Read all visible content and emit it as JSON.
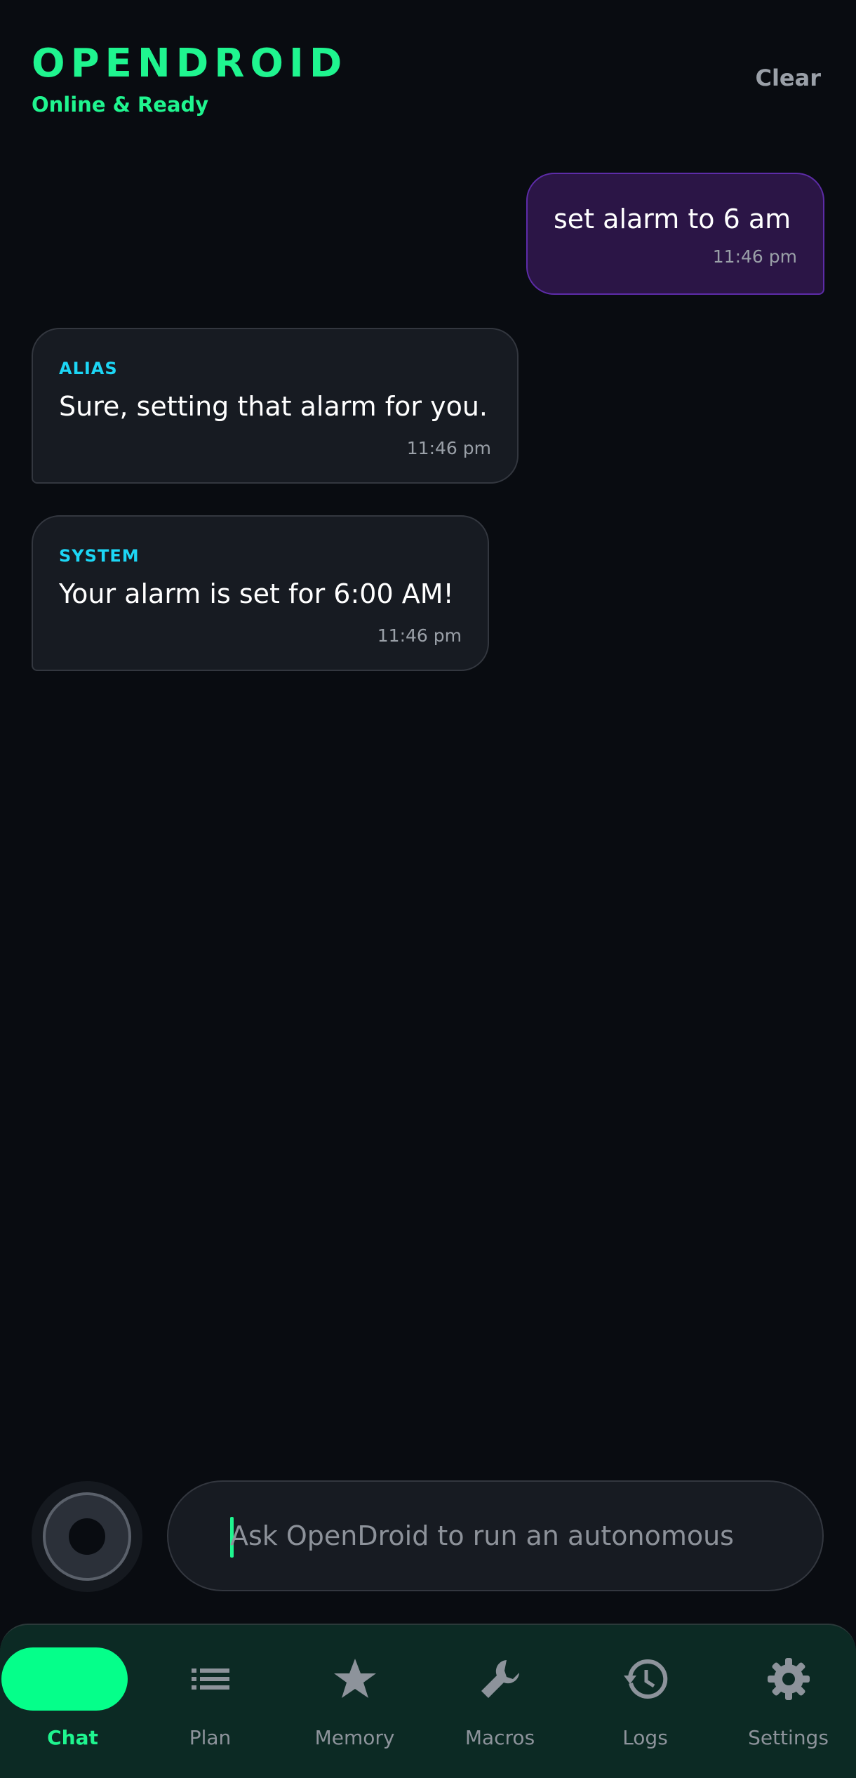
{
  "header": {
    "brand": "OPENDROID",
    "status": "Online & Ready",
    "clear_label": "Clear"
  },
  "messages": [
    {
      "role": "user",
      "text": "set alarm to 6 am",
      "time": "11:46 pm"
    },
    {
      "role": "assistant",
      "sender": "ALIAS",
      "text": "Sure, setting that alarm for you.",
      "time": "11:46 pm"
    },
    {
      "role": "system",
      "sender": "SYSTEM",
      "text": "Your alarm is set for 6:00 AM!",
      "time": "11:46 pm"
    }
  ],
  "composer": {
    "placeholder": "Ask OpenDroid to run an autonomous",
    "value": ""
  },
  "nav": {
    "active": "Chat",
    "items": [
      {
        "label": "Chat",
        "icon": "chat-icon"
      },
      {
        "label": "Plan",
        "icon": "list-icon"
      },
      {
        "label": "Memory",
        "icon": "star-icon"
      },
      {
        "label": "Macros",
        "icon": "wrench-icon"
      },
      {
        "label": "Logs",
        "icon": "history-icon"
      },
      {
        "label": "Settings",
        "icon": "gear-icon"
      }
    ]
  },
  "colors": {
    "accent": "#1ff58f",
    "sender_label": "#1cd6f5",
    "user_bubble": "#2b1546",
    "user_bubble_border": "#5d2ca8",
    "background": "#090c11",
    "nav_background": "#0c2a24"
  }
}
